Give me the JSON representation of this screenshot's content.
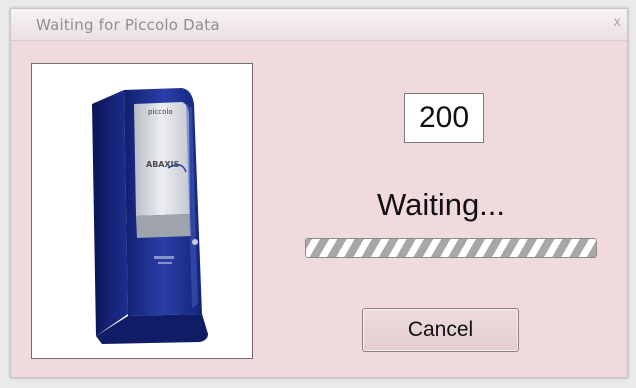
{
  "window": {
    "title": "Waiting for Piccolo Data",
    "close_glyph": "x"
  },
  "device_image": {
    "icon": "analyzer-device-image",
    "label_top": "piccolo",
    "brand": "ABAXIS"
  },
  "counter": {
    "value": "200"
  },
  "status": {
    "text": "Waiting..."
  },
  "progress": {
    "fraction": 1.0
  },
  "buttons": {
    "cancel_label": "Cancel"
  },
  "colors": {
    "window_bg": "#f1dadd",
    "device_blue": "#1c2f8c",
    "progress_stripe": "#a7a7a7"
  }
}
